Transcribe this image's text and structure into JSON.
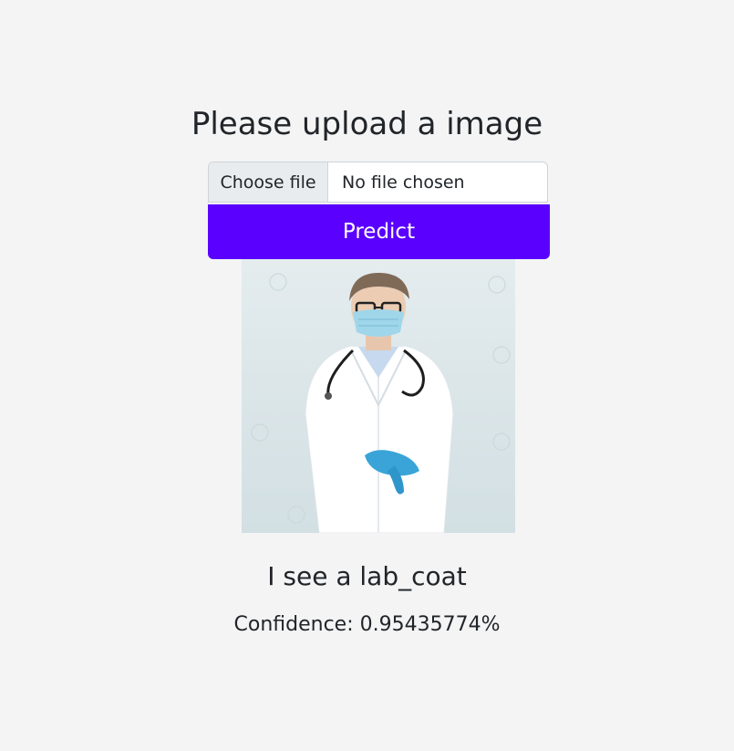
{
  "page": {
    "heading": "Please upload a image"
  },
  "upload": {
    "button_label": "Choose file",
    "status": "No file chosen"
  },
  "predict": {
    "label": "Predict"
  },
  "preview": {
    "subject": "doctor-in-lab-coat-photo"
  },
  "result": {
    "prediction": "I see a lab_coat",
    "confidence": "Confidence: 0.95435774%"
  },
  "colors": {
    "background": "#f4f4f4",
    "predict_button": "#5a00ff",
    "text": "#212529"
  }
}
